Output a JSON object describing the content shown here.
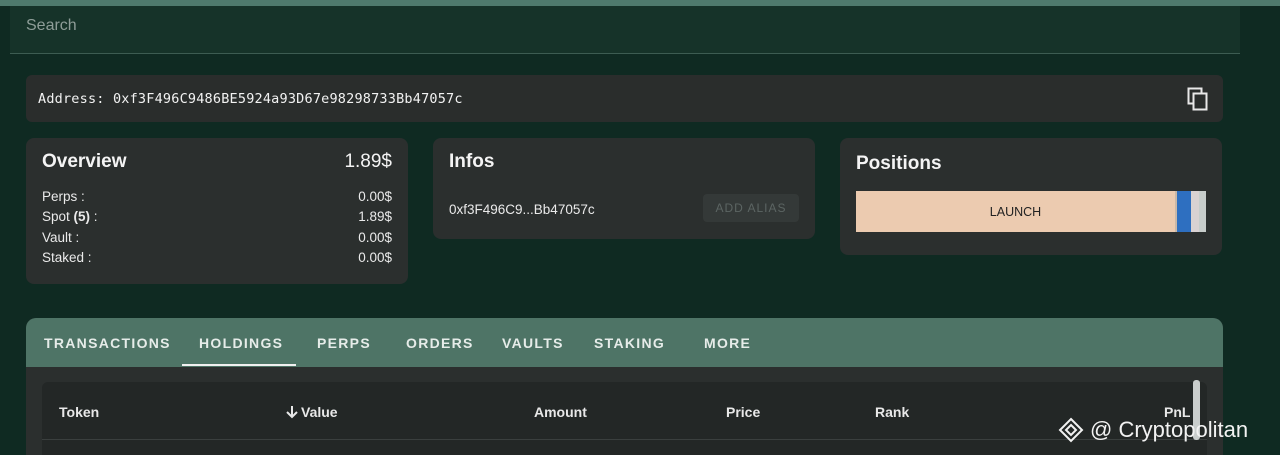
{
  "search": {
    "placeholder": "Search"
  },
  "address": {
    "label": "Address: 0xf3F496C9486BE5924a93D67e98298733Bb47057c"
  },
  "overview": {
    "title": "Overview",
    "total": "1.89$",
    "rows": [
      {
        "label": "Perps :",
        "value": "0.00$"
      },
      {
        "label_prefix": "Spot ",
        "label_bold": "(5)",
        "label_suffix": " :",
        "value": "1.89$"
      },
      {
        "label": "Vault :",
        "value": "0.00$"
      },
      {
        "label": "Staked :",
        "value": "0.00$"
      }
    ]
  },
  "infos": {
    "title": "Infos",
    "short_address": "0xf3F496C9...Bb47057c",
    "alias_button": "ADD ALIAS"
  },
  "positions": {
    "title": "Positions",
    "launch_label": "LAUNCH",
    "colors": {
      "launch": "#eccbb0",
      "blue": "#2e6fc0",
      "light": "#d9d2d2",
      "grey": "#c7cdcb"
    }
  },
  "tabs": {
    "items": [
      "TRANSACTIONS",
      "HOLDINGS",
      "PERPS",
      "ORDERS",
      "VAULTS",
      "STAKING",
      "MORE"
    ],
    "active": "HOLDINGS"
  },
  "table": {
    "columns": [
      "Token",
      "Value",
      "Amount",
      "Price",
      "Rank",
      "PnL"
    ],
    "sorted_column": "Value",
    "sort_direction": "down"
  },
  "watermark": {
    "text": "@ Cryptopolitan"
  },
  "icons": {
    "copy": "copy-icon",
    "sort": "arrow-down-icon",
    "brand": "diamond-logo-icon"
  }
}
